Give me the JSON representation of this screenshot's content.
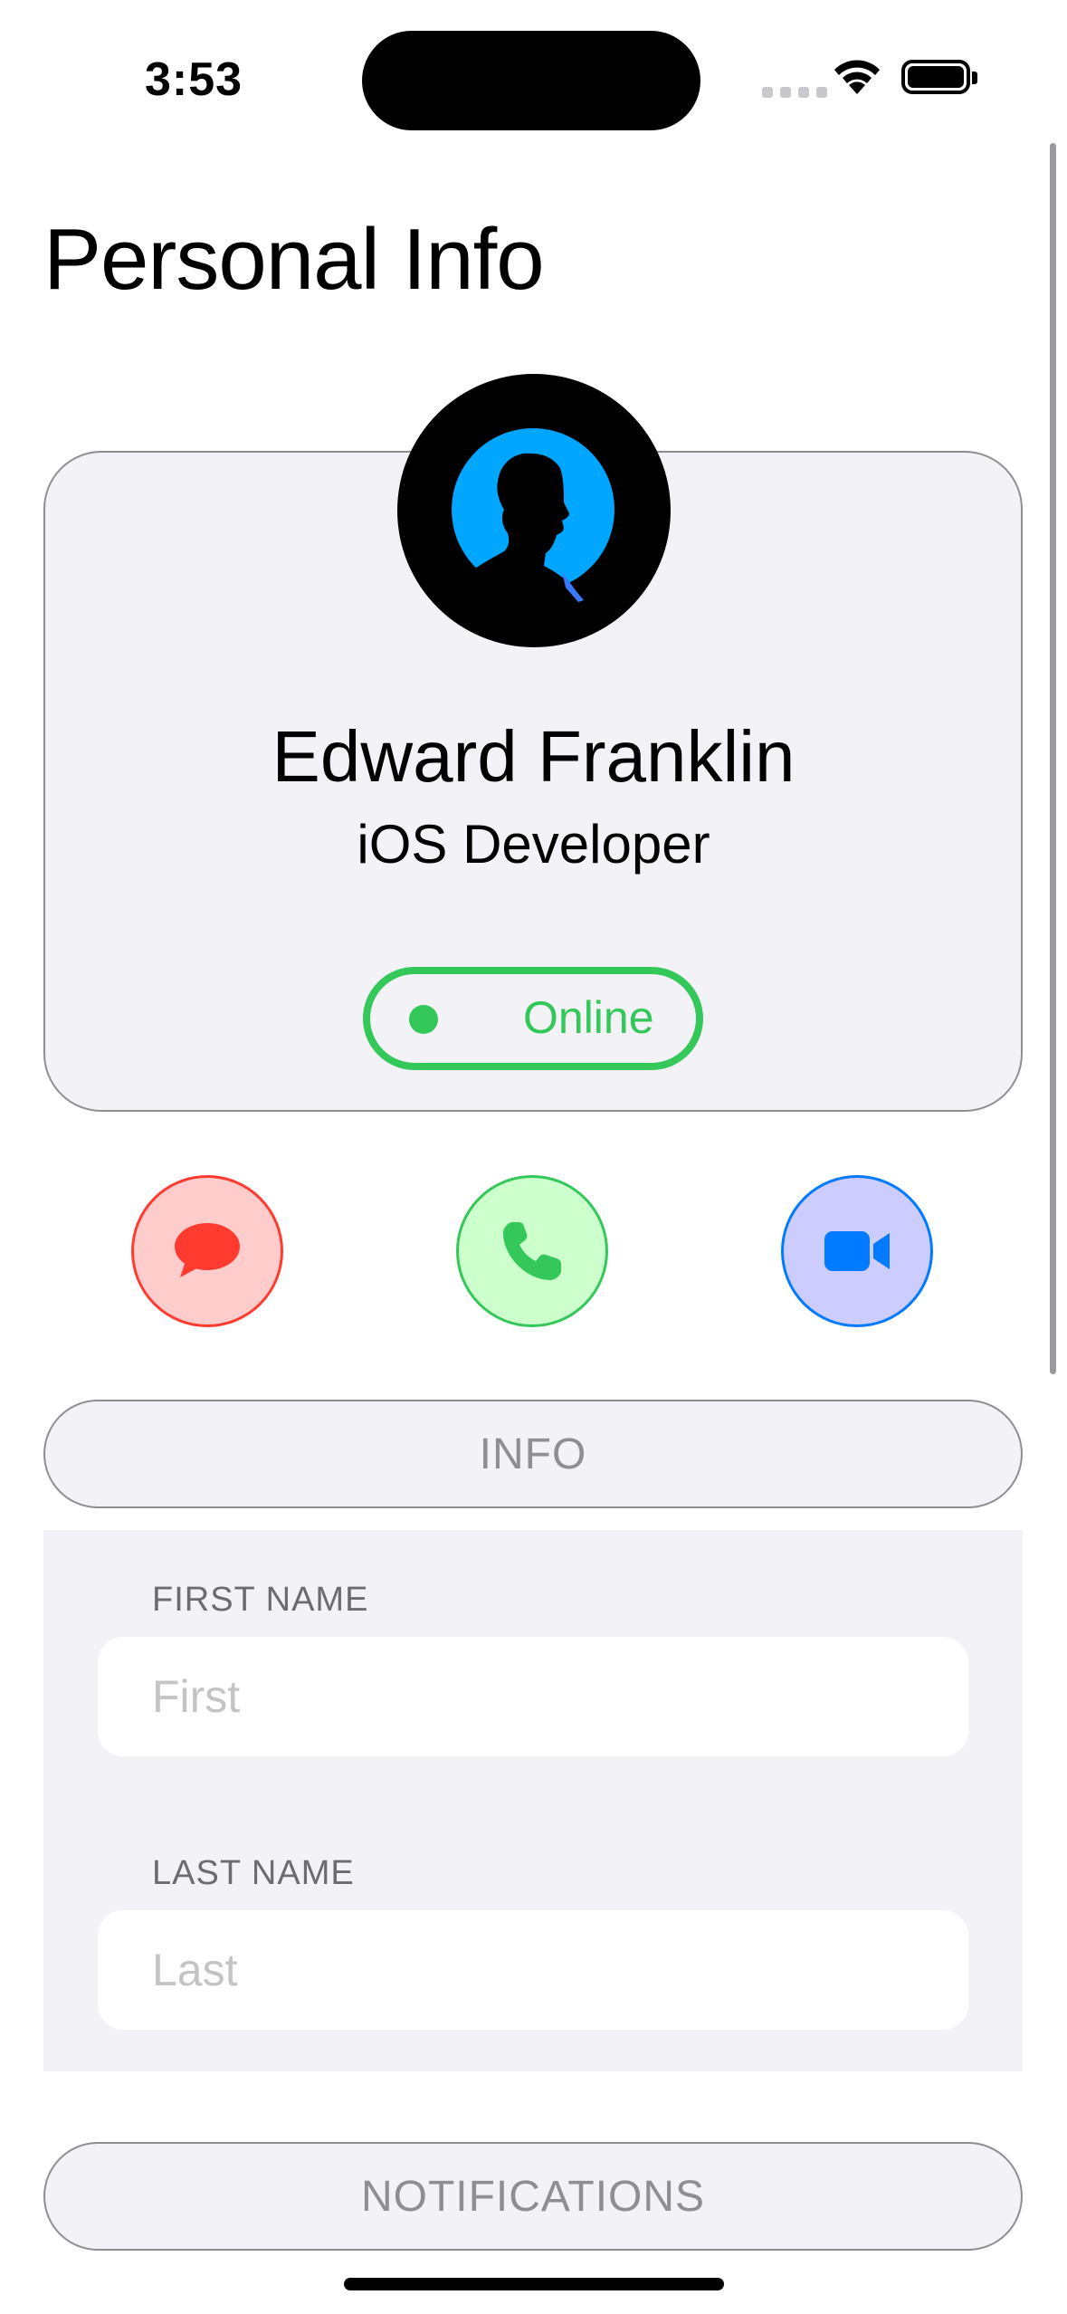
{
  "status_bar": {
    "time": "3:53"
  },
  "page": {
    "title": "Personal Info"
  },
  "profile": {
    "name": "Edward Franklin",
    "role": "iOS Developer",
    "status": "Online"
  },
  "actions": {
    "message_icon": "message-bubble-icon",
    "call_icon": "phone-icon",
    "video_icon": "video-camera-icon"
  },
  "sections": {
    "info_label": "INFO",
    "notifications_label": "NOTIFICATIONS"
  },
  "form": {
    "first_name": {
      "label": "FIRST NAME",
      "placeholder": "First",
      "value": ""
    },
    "last_name": {
      "label": "LAST NAME",
      "placeholder": "Last",
      "value": ""
    }
  },
  "colors": {
    "online_green": "#34c759",
    "message_red": "#ff3b30",
    "video_blue": "#007aff",
    "card_bg": "#f2f2f7",
    "avatar_blue": "#00a6ff"
  }
}
